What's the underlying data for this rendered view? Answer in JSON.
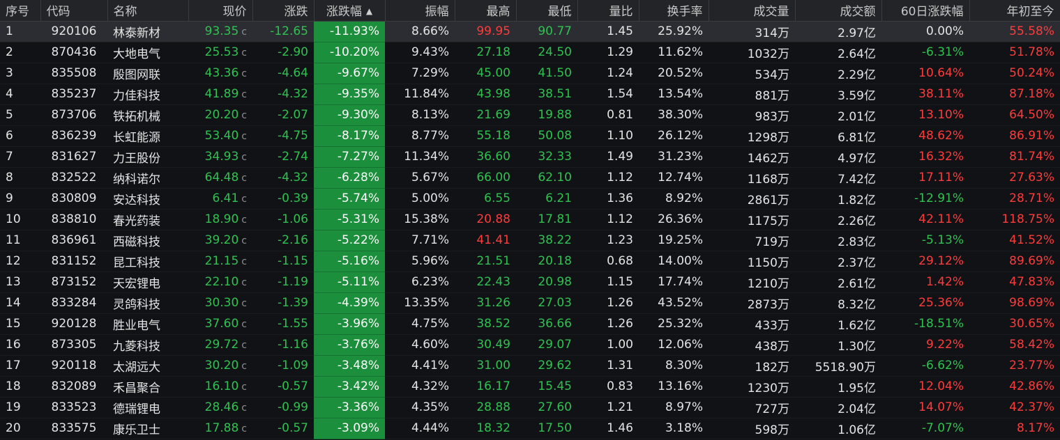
{
  "columns": [
    "序号",
    "代码",
    "名称",
    "现价",
    "涨跌",
    "涨跌幅",
    "振幅",
    "最高",
    "最低",
    "量比",
    "换手率",
    "成交量",
    "成交额",
    "60日涨跌幅",
    "年初至今"
  ],
  "sort_indicator": "▲",
  "price_flag": "c",
  "rows": [
    {
      "idx": "1",
      "code": "920106",
      "name": "林泰新材",
      "price": "93.35",
      "chg": "-12.65",
      "pct": "-11.93%",
      "amp": "8.66%",
      "high": "99.95",
      "high_dir": "up",
      "low": "90.77",
      "low_dir": "down",
      "vr": "1.45",
      "turn": "25.92%",
      "vol": "314万",
      "amt": "2.97亿",
      "d60": "0.00%",
      "d60_dir": "flat",
      "ytd": "55.58%",
      "ytd_dir": "up"
    },
    {
      "idx": "2",
      "code": "870436",
      "name": "大地电气",
      "price": "25.53",
      "chg": "-2.90",
      "pct": "-10.20%",
      "amp": "9.43%",
      "high": "27.18",
      "high_dir": "down",
      "low": "24.50",
      "low_dir": "down",
      "vr": "1.29",
      "turn": "11.62%",
      "vol": "1032万",
      "amt": "2.64亿",
      "d60": "-6.31%",
      "d60_dir": "down",
      "ytd": "51.78%",
      "ytd_dir": "up"
    },
    {
      "idx": "3",
      "code": "835508",
      "name": "殷图网联",
      "price": "43.36",
      "chg": "-4.64",
      "pct": "-9.67%",
      "amp": "7.29%",
      "high": "45.00",
      "high_dir": "down",
      "low": "41.50",
      "low_dir": "down",
      "vr": "1.24",
      "turn": "20.52%",
      "vol": "534万",
      "amt": "2.29亿",
      "d60": "10.64%",
      "d60_dir": "up",
      "ytd": "50.24%",
      "ytd_dir": "up"
    },
    {
      "idx": "4",
      "code": "835237",
      "name": "力佳科技",
      "price": "41.89",
      "chg": "-4.32",
      "pct": "-9.35%",
      "amp": "11.84%",
      "high": "43.98",
      "high_dir": "down",
      "low": "38.51",
      "low_dir": "down",
      "vr": "1.54",
      "turn": "13.54%",
      "vol": "881万",
      "amt": "3.59亿",
      "d60": "38.11%",
      "d60_dir": "up",
      "ytd": "87.18%",
      "ytd_dir": "up"
    },
    {
      "idx": "5",
      "code": "873706",
      "name": "铁拓机械",
      "price": "20.20",
      "chg": "-2.07",
      "pct": "-9.30%",
      "amp": "8.13%",
      "high": "21.69",
      "high_dir": "down",
      "low": "19.88",
      "low_dir": "down",
      "vr": "0.81",
      "turn": "38.30%",
      "vol": "983万",
      "amt": "2.01亿",
      "d60": "13.10%",
      "d60_dir": "up",
      "ytd": "64.50%",
      "ytd_dir": "up"
    },
    {
      "idx": "6",
      "code": "836239",
      "name": "长虹能源",
      "price": "53.40",
      "chg": "-4.75",
      "pct": "-8.17%",
      "amp": "8.77%",
      "high": "55.18",
      "high_dir": "down",
      "low": "50.08",
      "low_dir": "down",
      "vr": "1.10",
      "turn": "26.12%",
      "vol": "1298万",
      "amt": "6.81亿",
      "d60": "48.62%",
      "d60_dir": "up",
      "ytd": "86.91%",
      "ytd_dir": "up"
    },
    {
      "idx": "7",
      "code": "831627",
      "name": "力王股份",
      "price": "34.93",
      "chg": "-2.74",
      "pct": "-7.27%",
      "amp": "11.34%",
      "high": "36.60",
      "high_dir": "down",
      "low": "32.33",
      "low_dir": "down",
      "vr": "1.49",
      "turn": "31.23%",
      "vol": "1462万",
      "amt": "4.97亿",
      "d60": "16.32%",
      "d60_dir": "up",
      "ytd": "81.74%",
      "ytd_dir": "up"
    },
    {
      "idx": "8",
      "code": "832522",
      "name": "纳科诺尔",
      "price": "64.48",
      "chg": "-4.32",
      "pct": "-6.28%",
      "amp": "5.67%",
      "high": "66.00",
      "high_dir": "down",
      "low": "62.10",
      "low_dir": "down",
      "vr": "1.12",
      "turn": "12.74%",
      "vol": "1168万",
      "amt": "7.42亿",
      "d60": "17.11%",
      "d60_dir": "up",
      "ytd": "27.63%",
      "ytd_dir": "up"
    },
    {
      "idx": "9",
      "code": "830809",
      "name": "安达科技",
      "price": "6.41",
      "chg": "-0.39",
      "pct": "-5.74%",
      "amp": "5.00%",
      "high": "6.55",
      "high_dir": "down",
      "low": "6.21",
      "low_dir": "down",
      "vr": "1.36",
      "turn": "8.92%",
      "vol": "2861万",
      "amt": "1.82亿",
      "d60": "-12.91%",
      "d60_dir": "down",
      "ytd": "28.71%",
      "ytd_dir": "up"
    },
    {
      "idx": "10",
      "code": "838810",
      "name": "春光药装",
      "price": "18.90",
      "chg": "-1.06",
      "pct": "-5.31%",
      "amp": "15.38%",
      "high": "20.88",
      "high_dir": "up",
      "low": "17.81",
      "low_dir": "down",
      "vr": "1.12",
      "turn": "26.36%",
      "vol": "1175万",
      "amt": "2.26亿",
      "d60": "42.11%",
      "d60_dir": "up",
      "ytd": "118.75%",
      "ytd_dir": "up"
    },
    {
      "idx": "11",
      "code": "836961",
      "name": "西磁科技",
      "price": "39.20",
      "chg": "-2.16",
      "pct": "-5.22%",
      "amp": "7.71%",
      "high": "41.41",
      "high_dir": "up",
      "low": "38.22",
      "low_dir": "down",
      "vr": "1.23",
      "turn": "19.25%",
      "vol": "719万",
      "amt": "2.83亿",
      "d60": "-5.13%",
      "d60_dir": "down",
      "ytd": "41.52%",
      "ytd_dir": "up"
    },
    {
      "idx": "12",
      "code": "831152",
      "name": "昆工科技",
      "price": "21.15",
      "chg": "-1.15",
      "pct": "-5.16%",
      "amp": "5.96%",
      "high": "21.51",
      "high_dir": "down",
      "low": "20.18",
      "low_dir": "down",
      "vr": "0.68",
      "turn": "14.00%",
      "vol": "1150万",
      "amt": "2.37亿",
      "d60": "29.12%",
      "d60_dir": "up",
      "ytd": "89.69%",
      "ytd_dir": "up"
    },
    {
      "idx": "13",
      "code": "873152",
      "name": "天宏锂电",
      "price": "22.10",
      "chg": "-1.19",
      "pct": "-5.11%",
      "amp": "6.23%",
      "high": "22.43",
      "high_dir": "down",
      "low": "20.98",
      "low_dir": "down",
      "vr": "1.15",
      "turn": "17.74%",
      "vol": "1210万",
      "amt": "2.61亿",
      "d60": "1.42%",
      "d60_dir": "up",
      "ytd": "47.83%",
      "ytd_dir": "up"
    },
    {
      "idx": "14",
      "code": "833284",
      "name": "灵鸽科技",
      "price": "30.30",
      "chg": "-1.39",
      "pct": "-4.39%",
      "amp": "13.35%",
      "high": "31.26",
      "high_dir": "down",
      "low": "27.03",
      "low_dir": "down",
      "vr": "1.26",
      "turn": "43.52%",
      "vol": "2873万",
      "amt": "8.32亿",
      "d60": "25.36%",
      "d60_dir": "up",
      "ytd": "98.69%",
      "ytd_dir": "up"
    },
    {
      "idx": "15",
      "code": "920128",
      "name": "胜业电气",
      "price": "37.60",
      "chg": "-1.55",
      "pct": "-3.96%",
      "amp": "4.75%",
      "high": "38.52",
      "high_dir": "down",
      "low": "36.66",
      "low_dir": "down",
      "vr": "1.26",
      "turn": "25.32%",
      "vol": "433万",
      "amt": "1.62亿",
      "d60": "-18.51%",
      "d60_dir": "down",
      "ytd": "30.65%",
      "ytd_dir": "up"
    },
    {
      "idx": "16",
      "code": "873305",
      "name": "九菱科技",
      "price": "29.72",
      "chg": "-1.16",
      "pct": "-3.76%",
      "amp": "4.60%",
      "high": "30.49",
      "high_dir": "down",
      "low": "29.07",
      "low_dir": "down",
      "vr": "1.00",
      "turn": "12.06%",
      "vol": "438万",
      "amt": "1.30亿",
      "d60": "9.22%",
      "d60_dir": "up",
      "ytd": "58.42%",
      "ytd_dir": "up"
    },
    {
      "idx": "17",
      "code": "920118",
      "name": "太湖远大",
      "price": "30.20",
      "chg": "-1.09",
      "pct": "-3.48%",
      "amp": "4.41%",
      "high": "31.00",
      "high_dir": "down",
      "low": "29.62",
      "low_dir": "down",
      "vr": "1.31",
      "turn": "8.30%",
      "vol": "182万",
      "amt": "5518.90万",
      "d60": "-6.62%",
      "d60_dir": "down",
      "ytd": "23.77%",
      "ytd_dir": "up"
    },
    {
      "idx": "18",
      "code": "832089",
      "name": "禾昌聚合",
      "price": "16.10",
      "chg": "-0.57",
      "pct": "-3.42%",
      "amp": "4.32%",
      "high": "16.17",
      "high_dir": "down",
      "low": "15.45",
      "low_dir": "down",
      "vr": "0.83",
      "turn": "13.16%",
      "vol": "1230万",
      "amt": "1.95亿",
      "d60": "12.04%",
      "d60_dir": "up",
      "ytd": "42.86%",
      "ytd_dir": "up"
    },
    {
      "idx": "19",
      "code": "833523",
      "name": "德瑞锂电",
      "price": "28.46",
      "chg": "-0.99",
      "pct": "-3.36%",
      "amp": "4.35%",
      "high": "28.88",
      "high_dir": "down",
      "low": "27.60",
      "low_dir": "down",
      "vr": "1.21",
      "turn": "8.97%",
      "vol": "727万",
      "amt": "2.04亿",
      "d60": "14.07%",
      "d60_dir": "up",
      "ytd": "42.37%",
      "ytd_dir": "up"
    },
    {
      "idx": "20",
      "code": "833575",
      "name": "康乐卫士",
      "price": "17.88",
      "chg": "-0.57",
      "pct": "-3.09%",
      "amp": "4.44%",
      "high": "18.32",
      "high_dir": "down",
      "low": "17.50",
      "low_dir": "down",
      "vr": "1.46",
      "turn": "3.18%",
      "vol": "598万",
      "amt": "1.06亿",
      "d60": "-7.07%",
      "d60_dir": "down",
      "ytd": "8.17%",
      "ytd_dir": "up"
    }
  ]
}
